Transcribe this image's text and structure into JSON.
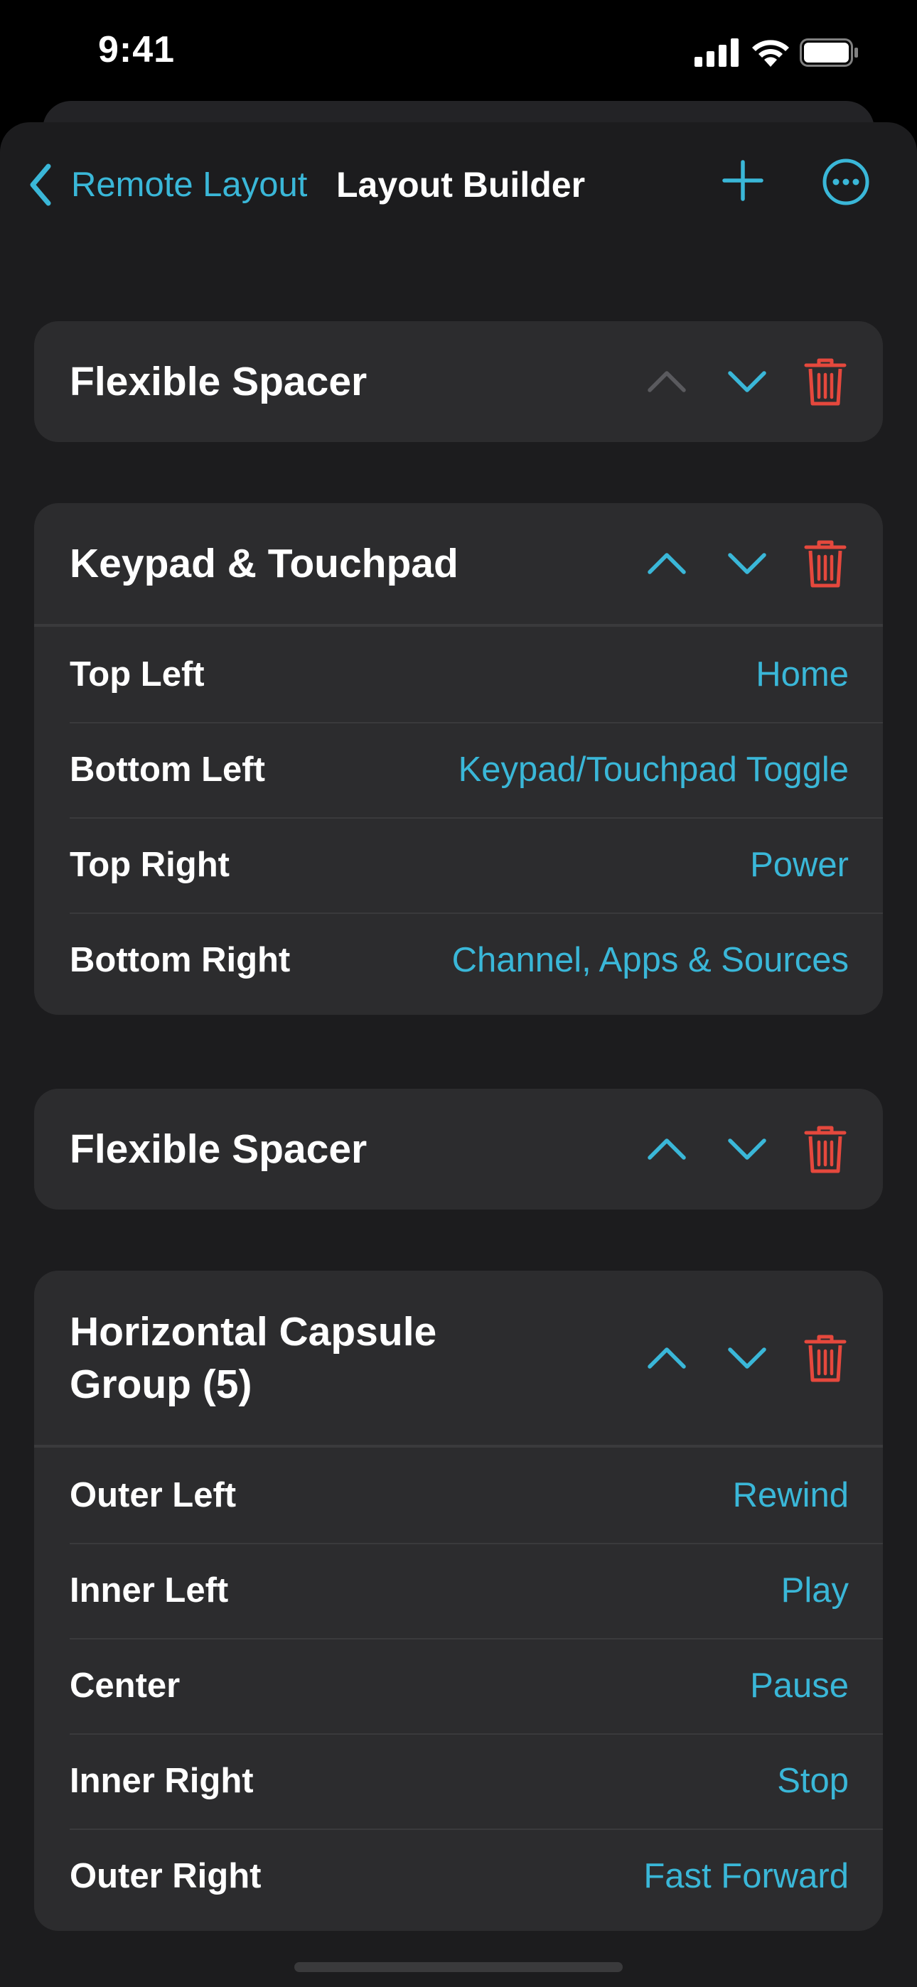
{
  "status_bar": {
    "time": "9:41"
  },
  "nav": {
    "back_label": "Remote Layout",
    "title": "Layout Builder"
  },
  "colors": {
    "accent": "#3ab7d8",
    "destructive": "#e5483d",
    "disabled": "#5a5a5e",
    "card": "#2c2c2e",
    "background": "#1c1c1e"
  },
  "sections": [
    {
      "title": "Flexible Spacer",
      "move_up_enabled": false,
      "move_down_enabled": true,
      "rows": []
    },
    {
      "title": "Keypad & Touchpad",
      "move_up_enabled": true,
      "move_down_enabled": true,
      "rows": [
        {
          "label": "Top Left",
          "value": "Home"
        },
        {
          "label": "Bottom Left",
          "value": "Keypad/Touchpad Toggle"
        },
        {
          "label": "Top Right",
          "value": "Power"
        },
        {
          "label": "Bottom Right",
          "value": "Channel, Apps & Sources"
        }
      ]
    },
    {
      "title": "Flexible Spacer",
      "move_up_enabled": true,
      "move_down_enabled": true,
      "rows": []
    },
    {
      "title": "Horizontal Capsule Group (5)",
      "move_up_enabled": true,
      "move_down_enabled": true,
      "rows": [
        {
          "label": "Outer Left",
          "value": "Rewind"
        },
        {
          "label": "Inner Left",
          "value": "Play"
        },
        {
          "label": "Center",
          "value": "Pause"
        },
        {
          "label": "Inner Right",
          "value": "Stop"
        },
        {
          "label": "Outer Right",
          "value": "Fast Forward"
        }
      ]
    }
  ]
}
